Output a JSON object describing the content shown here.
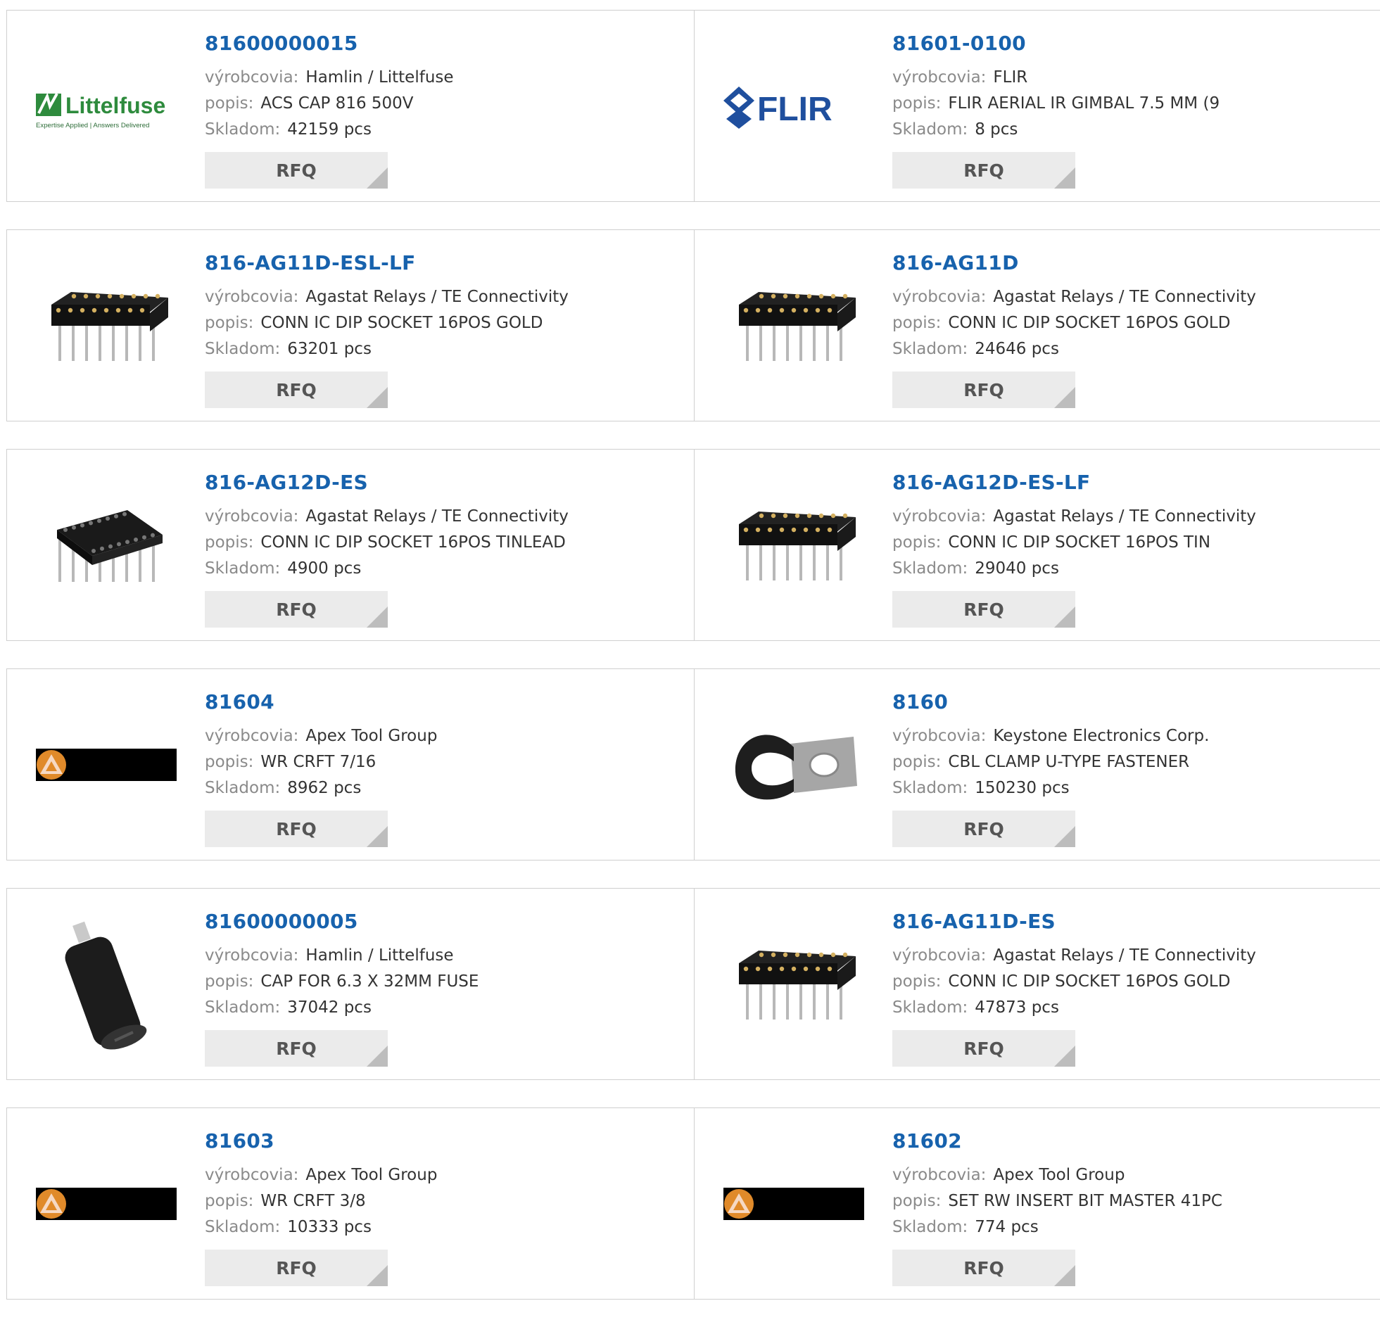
{
  "labels": {
    "manufacturer": "výrobcovia:",
    "description": "popis:",
    "stock": "Skladom:",
    "rfq": "RFQ"
  },
  "logos": {
    "littelfuse_name": "Littelfuse",
    "littelfuse_tagline": "Expertise Applied | Answers Delivered",
    "flir_name": "FLIR",
    "littelfuse_color": "#2e8b3d",
    "flir_color": "#1f4f9e",
    "apex_bar_color": "#000000"
  },
  "colors": {
    "part_number": "#1762ad",
    "label": "#8a8a8a",
    "value": "#333333",
    "rfq_bg": "#ebebeb"
  },
  "products": [
    {
      "part": "81600000015",
      "manufacturer": "Hamlin / Littelfuse",
      "description": "ACS CAP 816 500V",
      "stock": "42159 pcs",
      "image": "littelfuse-logo"
    },
    {
      "part": "81601-0100",
      "manufacturer": "FLIR",
      "description": "FLIR AERIAL IR GIMBAL 7.5 MM (9",
      "stock": "8 pcs",
      "image": "flir-logo"
    },
    {
      "part": "816-AG11D-ESL-LF",
      "manufacturer": "Agastat Relays / TE Connectivity",
      "description": "CONN IC DIP SOCKET 16POS GOLD",
      "stock": "63201 pcs",
      "image": "dip-socket"
    },
    {
      "part": "816-AG11D",
      "manufacturer": "Agastat Relays / TE Connectivity",
      "description": "CONN IC DIP SOCKET 16POS GOLD",
      "stock": "24646 pcs",
      "image": "dip-socket"
    },
    {
      "part": "816-AG12D-ES",
      "manufacturer": "Agastat Relays / TE Connectivity",
      "description": "CONN IC DIP SOCKET 16POS TINLEAD",
      "stock": "4900 pcs",
      "image": "dip-socket-angled"
    },
    {
      "part": "816-AG12D-ES-LF",
      "manufacturer": "Agastat Relays / TE Connectivity",
      "description": "CONN IC DIP SOCKET 16POS TIN",
      "stock": "29040 pcs",
      "image": "dip-socket"
    },
    {
      "part": "81604",
      "manufacturer": "Apex Tool Group",
      "description": "WR CRFT 7/16",
      "stock": "8962 pcs",
      "image": "apex-logo"
    },
    {
      "part": "8160",
      "manufacturer": "Keystone Electronics Corp.",
      "description": "CBL CLAMP U-TYPE FASTENER",
      "stock": "150230 pcs",
      "image": "cable-clamp"
    },
    {
      "part": "81600000005",
      "manufacturer": "Hamlin / Littelfuse",
      "description": "CAP FOR 6.3 X 32MM FUSE",
      "stock": "37042 pcs",
      "image": "fuse-cap"
    },
    {
      "part": "816-AG11D-ES",
      "manufacturer": "Agastat Relays / TE Connectivity",
      "description": "CONN IC DIP SOCKET 16POS GOLD",
      "stock": "47873 pcs",
      "image": "dip-socket"
    },
    {
      "part": "81603",
      "manufacturer": "Apex Tool Group",
      "description": "WR CRFT 3/8",
      "stock": "10333 pcs",
      "image": "apex-logo"
    },
    {
      "part": "81602",
      "manufacturer": "Apex Tool Group",
      "description": "SET RW INSERT BIT MASTER 41PC",
      "stock": "774 pcs",
      "image": "apex-logo"
    }
  ]
}
